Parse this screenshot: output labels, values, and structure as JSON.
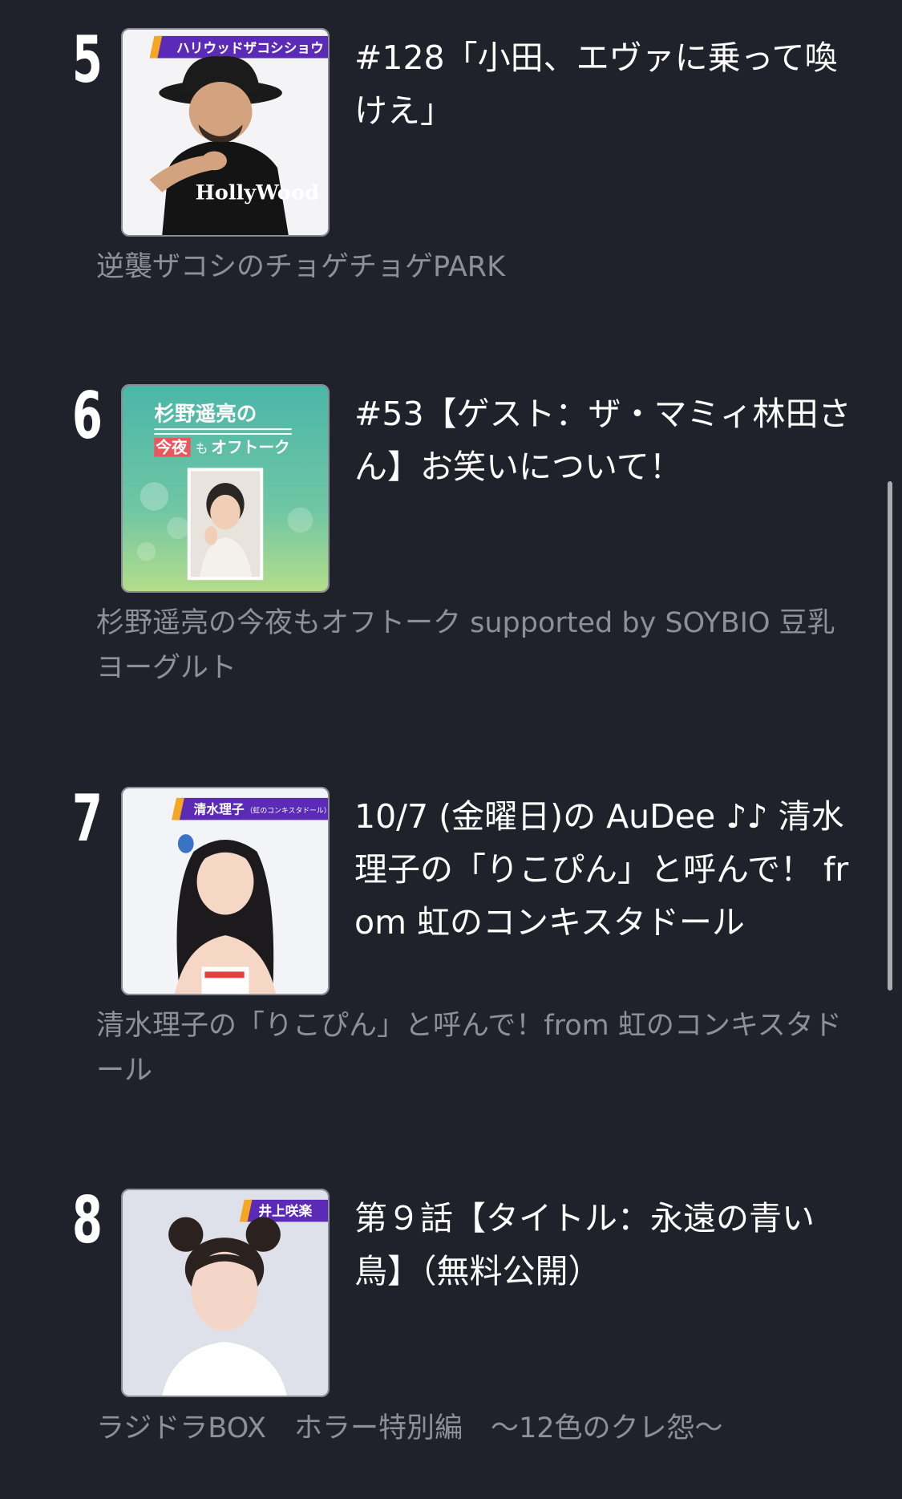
{
  "items": [
    {
      "rank": "5",
      "title": "#128「小田、エヴァに乗って喚けえ」",
      "show": "逆襲ザコシのチョゲチョゲPARK",
      "thumbnail_banner": "ハリウッドザコシショウ",
      "thumbnail_shirt_text": "HollyWood"
    },
    {
      "rank": "6",
      "title": "#53【ゲスト：ザ・マミィ林田さん】お笑いについて！",
      "show": "杉野遥亮の今夜もオフトーク supported by SOYBIO 豆乳ヨーグルト",
      "thumbnail_title_line1": "杉野遥亮の",
      "thumbnail_title_line2_a": "今夜",
      "thumbnail_title_line2_b": "も",
      "thumbnail_title_line2_c": "オフトーク"
    },
    {
      "rank": "7",
      "title": "10/7 (金曜日)の AuDee ♪♪ 清水理子の「りこぴん」と呼んで！ from 虹のコンキスタドール",
      "show": "清水理子の「りこぴん」と呼んで！from 虹のコンキスタドール",
      "thumbnail_banner": "清水理子",
      "thumbnail_banner_sub": "（虹のコンキスタドール）"
    },
    {
      "rank": "8",
      "title": "第９話【タイトル：永遠の青い鳥】（無料公開）",
      "show": "ラジドラBOX　ホラー特別編　〜12色のクレ怨〜",
      "thumbnail_banner": "井上咲楽"
    }
  ],
  "colors": {
    "background": "#1f222b",
    "title_text": "#ffffff",
    "show_text": "#8d9099",
    "banner_purple": "#5b2bb8",
    "banner_accent": "#f5a623",
    "scrollbar": "#a9abb2"
  }
}
